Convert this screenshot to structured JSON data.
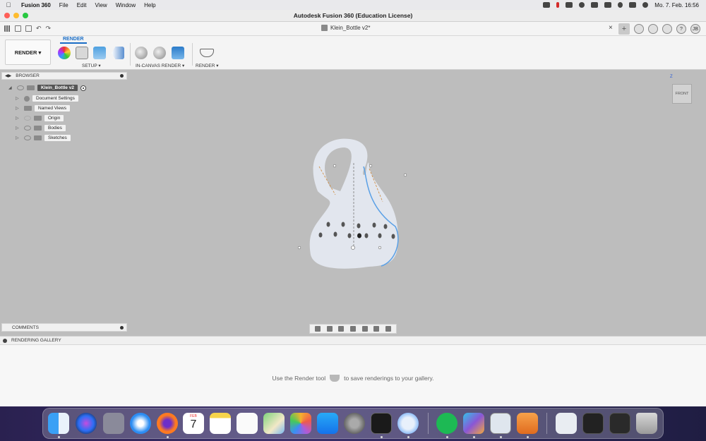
{
  "menubar": {
    "app_name": "Fusion 360",
    "items": [
      "File",
      "Edit",
      "View",
      "Window",
      "Help"
    ],
    "clock": "Mo. 7. Feb.  16:56"
  },
  "window": {
    "title": "Autodesk Fusion 360 (Education License)"
  },
  "document_tab": {
    "title": "Klein_Bottle v2*",
    "close": "×",
    "user_initials": "JB"
  },
  "ribbon": {
    "workspace": "RENDER ▾",
    "active_tab": "RENDER",
    "groups": {
      "setup": "SETUP ▾",
      "in_canvas": "IN-CANVAS RENDER ▾",
      "render": "RENDER ▾"
    }
  },
  "browser": {
    "title": "BROWSER",
    "root": "Klein_Bottle v2",
    "items": [
      {
        "label": "Document Settings"
      },
      {
        "label": "Named Views"
      },
      {
        "label": "Origin"
      },
      {
        "label": "Bodies"
      },
      {
        "label": "Sketches"
      }
    ]
  },
  "viewcube": {
    "face": "FRONT",
    "axis": "Z"
  },
  "comments": {
    "title": "COMMENTS"
  },
  "gallery": {
    "title": "RENDERING GALLERY",
    "message_before": "Use the Render tool",
    "message_after": "to save renderings to your gallery."
  },
  "dock": {
    "calendar_month": "FEB",
    "calendar_day": "7"
  },
  "colors": {
    "accent": "#1a6dc6",
    "viewport_bg": "#bdbdbd",
    "model_body": "#e2e6ee",
    "selection_edge": "#5aa0e6"
  }
}
